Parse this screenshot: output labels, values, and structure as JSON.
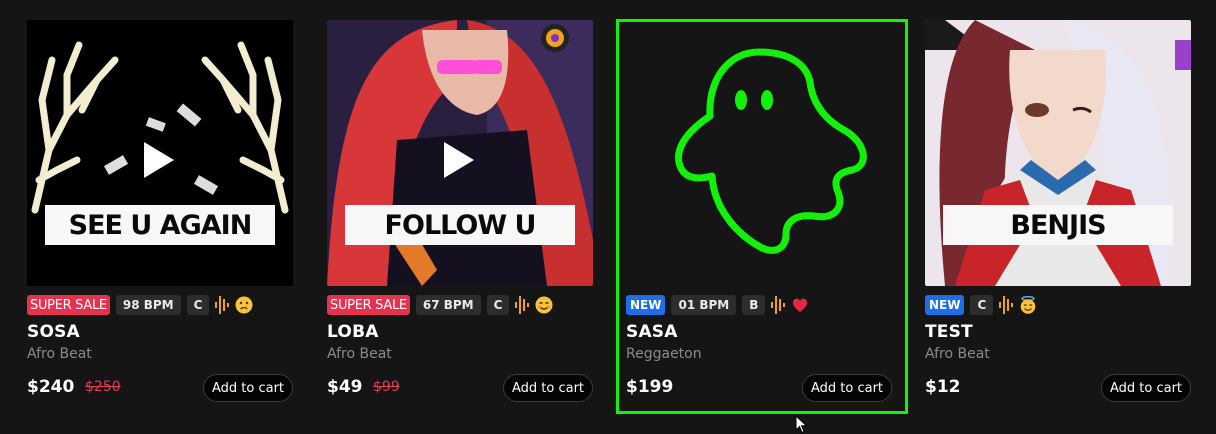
{
  "beats": [
    {
      "art_title": "SEE U AGAIN",
      "badge": "SUPER SALE",
      "bpm": "98 BPM",
      "key": "C",
      "emoji": "crying-face-emoji",
      "name": "SOSA",
      "genre": "Afro Beat",
      "price": "$240",
      "old_price": "$250",
      "cart_label": "Add to cart"
    },
    {
      "art_title": "FOLLOW U",
      "badge": "SUPER SALE",
      "bpm": "67 BPM",
      "key": "C",
      "emoji": "smiling-face-emoji",
      "name": "LOBA",
      "genre": "Afro Beat",
      "price": "$49",
      "old_price": "$99",
      "cart_label": "Add to cart"
    },
    {
      "art_title": "",
      "badge": "NEW",
      "bpm": "01 BPM",
      "key": "B",
      "emoji": "heart-icon",
      "name": "SASA",
      "genre": "Reggaeton",
      "price": "$199",
      "old_price": "",
      "cart_label": "Add to cart"
    },
    {
      "art_title": "BENJIS",
      "badge": "NEW",
      "bpm": "",
      "key": "C",
      "emoji": "halo-face-emoji",
      "name": "TEST",
      "genre": "Afro Beat",
      "price": "$12",
      "old_price": "",
      "cart_label": "Add to cart"
    }
  ],
  "colors": {
    "sale": "#e5334f",
    "new": "#1e6ee8",
    "selection": "#13f10b",
    "wave": "#f0a21a",
    "strike": "#e23c57"
  },
  "selected_index": 2
}
